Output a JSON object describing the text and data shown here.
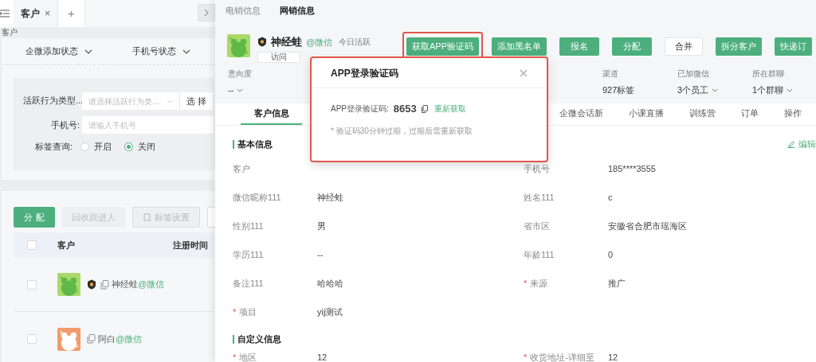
{
  "left": {
    "tabs": [
      {
        "label": "客户",
        "selected": true,
        "close": "×"
      },
      {
        "label": "+",
        "selected": false
      }
    ],
    "breadcrumb": "客户",
    "filters": [
      {
        "label": "企微添加状态"
      },
      {
        "label": "手机号状态"
      }
    ],
    "form": {
      "activity": {
        "label": "活跃行为类型...",
        "placeholder": "请选择活跃行为类...",
        "button": "选 择"
      },
      "phone": {
        "label": "手机号:",
        "placeholder": "请输入手机号"
      },
      "tag_query": {
        "label": "标签查询:",
        "options": [
          {
            "label": "开启",
            "selected": false
          },
          {
            "label": "关闭",
            "selected": true
          }
        ]
      }
    },
    "actions": [
      {
        "label": "分 配",
        "kind": "primary"
      },
      {
        "label": "回收跟进人",
        "kind": "disabled"
      },
      {
        "label": "标签设置",
        "kind": "icon"
      },
      {
        "kind": "blank"
      }
    ],
    "table": {
      "columns": [
        "客户",
        "注册时间"
      ],
      "header_checked": false,
      "rows": [
        {
          "checked": false,
          "badge": true,
          "name": "神经蛙",
          "channel": "@微信"
        },
        {
          "checked": false,
          "badge": false,
          "name": "阿白",
          "channel": "@微信"
        }
      ]
    }
  },
  "drawer": {
    "tabs": [
      {
        "label": "电销信息",
        "selected": false
      },
      {
        "label": "网销信息",
        "selected": true
      }
    ],
    "customer": {
      "name": "神经蛙",
      "channel": "@微信",
      "activity": "今日活跃",
      "tags": [
        "访问"
      ]
    },
    "actions": [
      {
        "label": "获取APP验证码",
        "kind": "primary",
        "highlighted": true
      },
      {
        "label": "添加黑名单",
        "kind": "primary",
        "highlighted": false
      },
      {
        "label": "报名",
        "kind": "primary",
        "highlighted": false
      },
      {
        "label": "分配",
        "kind": "primary",
        "highlighted": false
      },
      {
        "label": "合并",
        "kind": "default",
        "highlighted": false
      },
      {
        "label": "拆分客户",
        "kind": "primary",
        "highlighted": false
      },
      {
        "label": "快递订",
        "kind": "primary",
        "highlighted": false
      }
    ],
    "stats": [
      {
        "label": "意向度",
        "value": "--",
        "dropdown": true
      },
      {
        "label": "渠道",
        "value": "927标签",
        "dropdown": false
      },
      {
        "label": "已加微信",
        "value": "3个员工",
        "dropdown": true
      },
      {
        "label": "所在群聊",
        "value": "1个群聊",
        "dropdown": true
      }
    ],
    "info_tabs": [
      {
        "label": "客户信息",
        "selected": true
      },
      {
        "label": "企微会话新",
        "selected": false
      },
      {
        "label": "小课直播",
        "selected": false
      },
      {
        "label": "训练营",
        "selected": false
      },
      {
        "label": "订单",
        "selected": false
      },
      {
        "label": "操作",
        "selected": false
      }
    ],
    "edit": "编辑",
    "sections": [
      {
        "title": "基本信息",
        "fields": [
          {
            "label": "客户"
          },
          {
            "label": "手机号",
            "value": "185****3555"
          },
          {
            "label": "微信昵称111",
            "value": "神经蛙"
          },
          {
            "label": "姓名111",
            "value": "c"
          },
          {
            "label": "性别111",
            "value": "男"
          },
          {
            "label": "省市区",
            "value": "安徽省合肥市瑶海区"
          },
          {
            "label": "学历111",
            "value": "--"
          },
          {
            "label": "年龄111",
            "value": "0"
          },
          {
            "label": "备注111",
            "value": "哈哈哈"
          },
          {
            "label": "来源",
            "value": "推广",
            "required_mark": "*"
          },
          {
            "label": "项目",
            "value": "yij测试",
            "required_mark": "*"
          }
        ]
      },
      {
        "title": "自定义信息",
        "fields": [
          {
            "label": "地区",
            "value": "12",
            "required_mark": "*"
          },
          {
            "label": "收货地址-详细至",
            "value": "12",
            "required_mark": "*"
          }
        ]
      }
    ]
  },
  "dialog": {
    "title": "APP登录验证码",
    "code_label": "APP登录验证码:",
    "code": "8653",
    "refresh": "重新获取",
    "note": "* 验证码30分钟过期，过期后需重新获取",
    "highlighted": true
  }
}
